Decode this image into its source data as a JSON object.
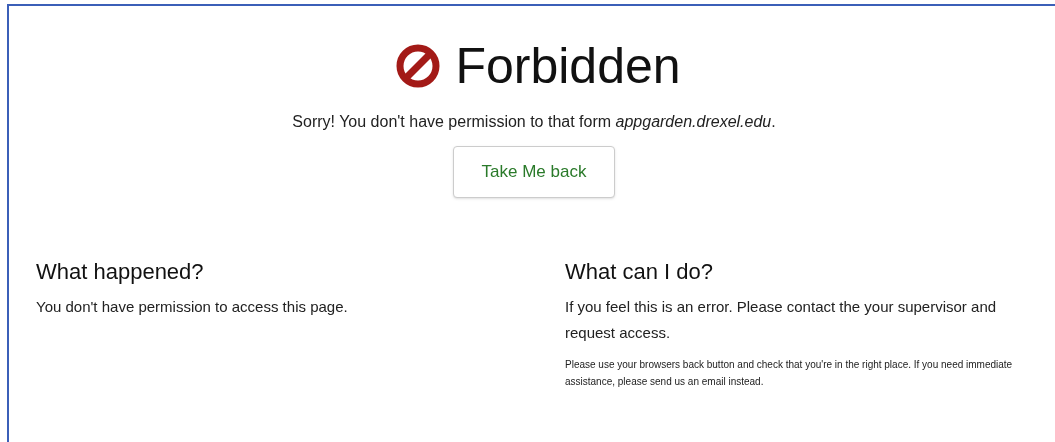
{
  "title": "Forbidden",
  "message": "Sorry! You don't have permission to that form *appgarden.drexel.edu*.",
  "back_button": "Take Me back",
  "sections": [
    {
      "heading": "What happened?",
      "paragraphs": [
        "You don't have permission to access this page."
      ]
    },
    {
      "heading": "What can I do?",
      "paragraphs": [
        "If you feel this is an error. Please contact the your supervisor and request access.",
        "Please use your browsers back button and check that you're in the right place. If you need immediate assistance, please send us an email instead."
      ]
    }
  ]
}
